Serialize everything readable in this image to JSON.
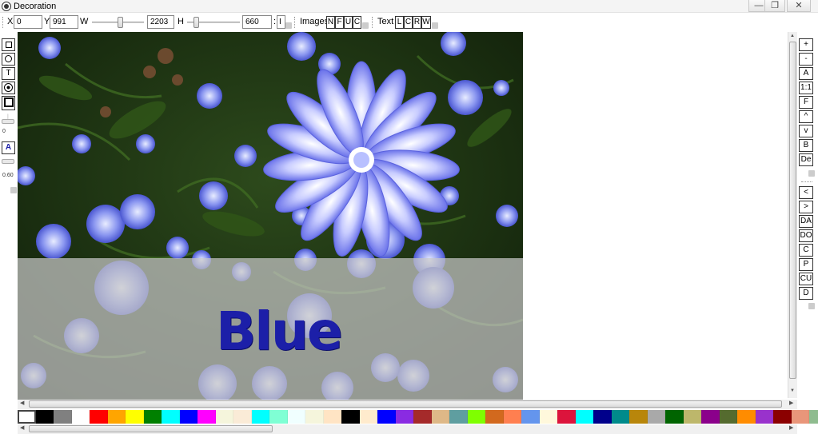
{
  "window": {
    "title": "Decoration",
    "buttons": {
      "minimize": "—",
      "restore": "❐",
      "close": "✕"
    }
  },
  "toolbar": {
    "x_label": "X",
    "x_value": "0",
    "y_label": "Y",
    "y_value": "991",
    "w_label": "W",
    "w_value": "2203",
    "h_label": "H",
    "h_value": "660",
    "colon_label": ":",
    "i_label": "I",
    "images_label": "Images",
    "images_buttons": [
      "N",
      "F",
      "U",
      "C"
    ],
    "text_label": "Text",
    "text_buttons": [
      "L",
      "C",
      "R",
      "W"
    ]
  },
  "left_tools": {
    "rect_icon": "rectangle-icon",
    "ellipse_icon": "ellipse-icon",
    "text_tool": "T",
    "image_icon": "image-icon",
    "fill_icon": "fill-icon",
    "slider_value_1": "0",
    "font_tool": "A",
    "slider_value_2": "0.60"
  },
  "canvas": {
    "overlay_text": "Blue",
    "overlay_text_color": "#1c1fa8"
  },
  "right_tools_top": [
    "+",
    "-",
    "A",
    "1:1",
    "F",
    "^",
    "v",
    "B",
    "De"
  ],
  "right_tools_bottom": [
    "<",
    ">",
    "DA",
    "DO",
    "C",
    "P",
    "CU",
    "D"
  ],
  "palette": [
    "#ffffff",
    "#000000",
    "#808080",
    "#ffffff",
    "#ff0000",
    "#ffa500",
    "#ffff00",
    "#008000",
    "#00ffff",
    "#0000ff",
    "#ff00ff",
    "#f5f5dc",
    "#faebd7",
    "#00ffff",
    "#7fffd4",
    "#f0ffff",
    "#f5f5dc",
    "#ffe4c4",
    "#000000",
    "#ffebcd",
    "#0000ff",
    "#8a2be2",
    "#a52a2a",
    "#deb887",
    "#5f9ea0",
    "#7fff00",
    "#d2691e",
    "#ff7f50",
    "#6495ed",
    "#fff8dc",
    "#dc143c",
    "#00ffff",
    "#00008b",
    "#008b8b",
    "#b8860b",
    "#a9a9a9",
    "#006400",
    "#bdb76b",
    "#8b008b",
    "#556b2f",
    "#ff8c00",
    "#9932cc",
    "#8b0000",
    "#e9967a",
    "#8fbc8f",
    "#483d8b"
  ]
}
